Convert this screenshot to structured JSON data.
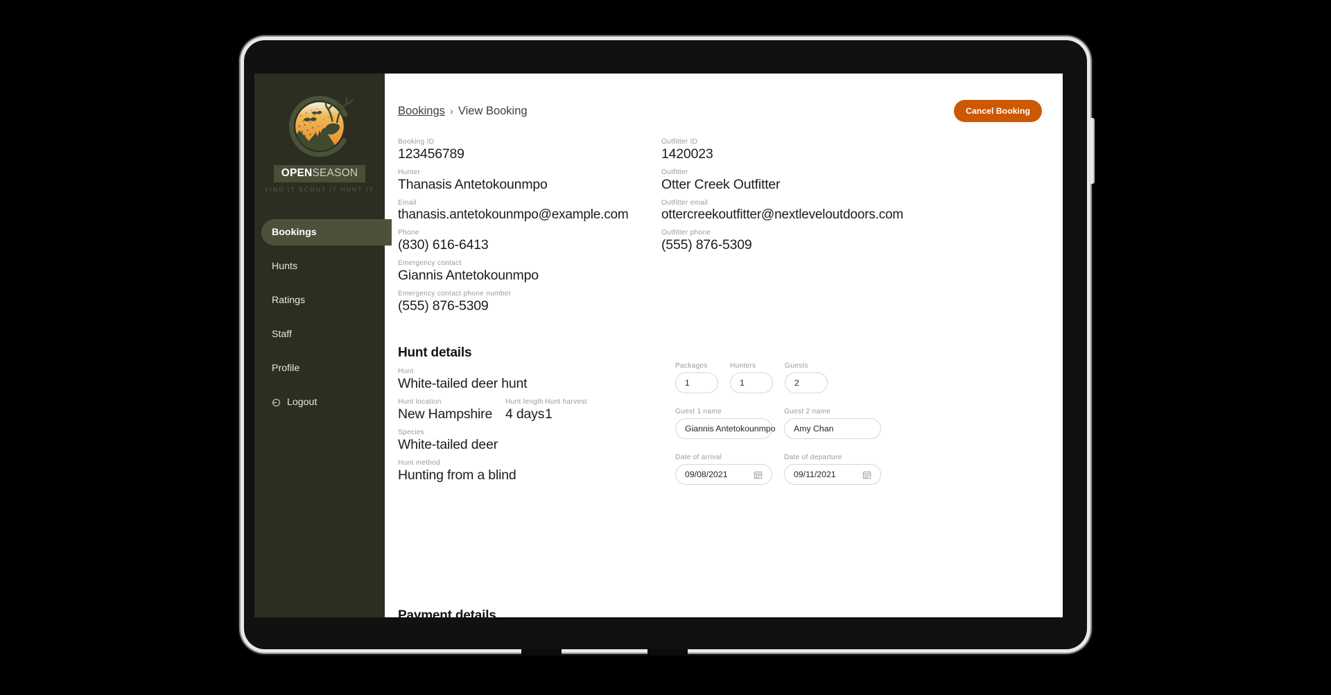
{
  "sidebar": {
    "logo": {
      "word_open": "OPEN",
      "word_season": "SEASON",
      "tagline": "FIND IT   SCOUT IT   HUNT IT"
    },
    "items": [
      {
        "label": "Bookings",
        "active": true,
        "icon": ""
      },
      {
        "label": "Hunts",
        "active": false,
        "icon": ""
      },
      {
        "label": "Ratings",
        "active": false,
        "icon": ""
      },
      {
        "label": "Staff",
        "active": false,
        "icon": ""
      },
      {
        "label": "Profile",
        "active": false,
        "icon": ""
      },
      {
        "label": "Logout",
        "active": false,
        "icon": "logout-icon"
      }
    ]
  },
  "breadcrumb": {
    "root": "Bookings",
    "separator": "›",
    "current": "View Booking"
  },
  "actions": {
    "cancel_booking": "Cancel Booking",
    "cancel_booking_color": "#cc5803"
  },
  "booking": {
    "left": [
      {
        "label": "Booking ID",
        "value": "123456789"
      },
      {
        "label": "Hunter",
        "value": "Thanasis Antetokounmpo"
      },
      {
        "label": "Email",
        "value": "thanasis.antetokounmpo@example.com"
      },
      {
        "label": "Phone",
        "value": "(830) 616-6413"
      },
      {
        "label": "Emergency contact",
        "value": "Giannis Antetokounmpo"
      },
      {
        "label": "Emergency contact phone number",
        "value": "(555) 876-5309"
      }
    ],
    "right": [
      {
        "label": "Outfitter ID",
        "value": "1420023"
      },
      {
        "label": "Outfitter",
        "value": "Otter Creek Outfitter"
      },
      {
        "label": "Outfitter email",
        "value": "ottercreekoutfitter@nextleveloutdoors.com"
      },
      {
        "label": "Outfitter phone",
        "value": "(555) 876-5309"
      }
    ]
  },
  "hunt_details": {
    "title": "Hunt details",
    "hunt_label": "Hunt",
    "hunt_value": "White-tailed deer hunt",
    "location_label": "Hunt location",
    "location_value": "New Hampshire",
    "length_label": "Hunt length",
    "length_value": "4 days",
    "harvest_label": "Hunt harvest",
    "harvest_value": "1",
    "species_label": "Species",
    "species_value": "White-tailed deer",
    "method_label": "Hunt method",
    "method_value": "Hunting from a blind",
    "packages_label": "Packages",
    "packages_value": "1",
    "hunters_label": "Hunters",
    "hunters_value": "1",
    "guests_label": "Guests",
    "guests_value": "2",
    "guest1_label": "Guest 1 name",
    "guest1_value": "Giannis Antetokounmpo",
    "guest2_label": "Guest 2 name",
    "guest2_value": "Amy Chan",
    "arrival_label": "Date of arrival",
    "arrival_value": "09/08/2021",
    "departure_label": "Date of departure",
    "departure_value": "09/11/2021",
    "calendar_icon": "calendar-icon"
  },
  "payment": {
    "title": "Payment details"
  }
}
